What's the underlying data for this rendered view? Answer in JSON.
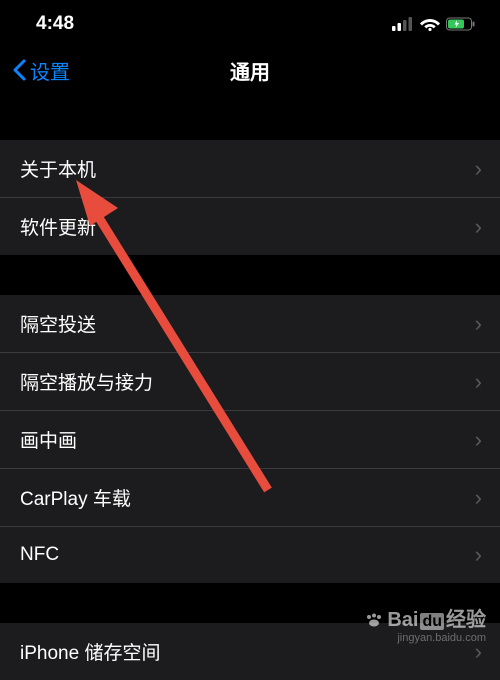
{
  "status": {
    "time": "4:48"
  },
  "nav": {
    "back_label": "设置",
    "title": "通用"
  },
  "sections": {
    "s1": {
      "about": "关于本机",
      "update": "软件更新"
    },
    "s2": {
      "airdrop": "隔空投送",
      "airplay": "隔空播放与接力",
      "pip": "画中画",
      "carplay": "CarPlay 车载",
      "nfc": "NFC"
    },
    "s3": {
      "storage": "iPhone 储存空间"
    }
  },
  "watermark": {
    "brand": "Bai",
    "brand2": "经验",
    "url": "jingyan.baidu.com"
  },
  "colors": {
    "accent": "#0a84ff",
    "arrow": "#e74c3c"
  }
}
